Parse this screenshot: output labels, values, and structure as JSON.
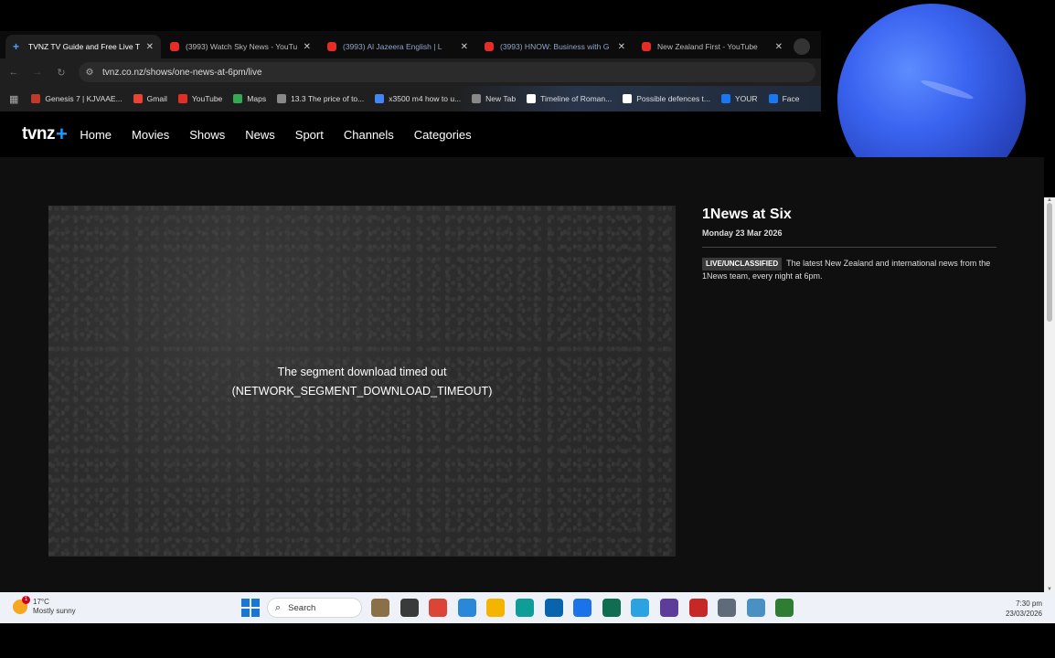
{
  "tabs": [
    {
      "title": "TVNZ TV Guide and Free Live T",
      "active": true,
      "icon": "tvnz-icon"
    },
    {
      "title": "(3993) Watch Sky News - YouTu",
      "active": false,
      "icon": "youtube-icon"
    },
    {
      "title": "(3993) Al Jazeera English | L",
      "active": false,
      "icon": "youtube-icon"
    },
    {
      "title": "(3993) HNOW: Business with G",
      "active": false,
      "icon": "youtube-icon"
    },
    {
      "title": "New Zealand First - YouTube",
      "active": false,
      "icon": "youtube-icon"
    }
  ],
  "toolbar": {
    "url": "tvnz.co.nz/shows/one-news-at-6pm/live"
  },
  "bookmarks": [
    {
      "label": "Genesis 7 | KJVAAE...",
      "icon": "bookmark-icon",
      "color": "#c0392b"
    },
    {
      "label": "Gmail",
      "icon": "gmail-icon",
      "color": "#ea4335"
    },
    {
      "label": "YouTube",
      "icon": "youtube-icon",
      "color": "#e52d27"
    },
    {
      "label": "Maps",
      "icon": "maps-icon",
      "color": "#34a853"
    },
    {
      "label": "13.3 The price of to...",
      "icon": "page-icon",
      "color": "#888888"
    },
    {
      "label": "x3500 m4 how to u...",
      "icon": "google-icon",
      "color": "#4285f4"
    },
    {
      "label": "New Tab",
      "icon": "page-icon",
      "color": "#888888"
    },
    {
      "label": "Timeline of Roman...",
      "icon": "wikipedia-icon",
      "color": "#ffffff"
    },
    {
      "label": "Possible defences t...",
      "icon": "cl-icon",
      "color": "#ffffff"
    },
    {
      "label": "YOUR",
      "icon": "facebook-icon",
      "color": "#1877f2"
    },
    {
      "label": "Face",
      "icon": "facebook-icon",
      "color": "#1877f2"
    }
  ],
  "site": {
    "logo": "tvnz",
    "logo_plus": "+",
    "nav": [
      "Home",
      "Movies",
      "Shows",
      "News",
      "Sport",
      "Channels",
      "Categories"
    ]
  },
  "player": {
    "error_line1": "The segment download timed out",
    "error_line2": "(NETWORK_SEGMENT_DOWNLOAD_TIMEOUT)"
  },
  "info": {
    "title": "1News at Six",
    "date": "Monday 23 Mar 2026",
    "badge": "LIVE/UNCLASSIFIED",
    "description": "The latest New Zealand and international news from the 1News team, every night at 6pm."
  },
  "taskbar": {
    "weather_temp": "17°C",
    "weather_desc": "Mostly sunny",
    "weather_alert": "1",
    "search_label": "Search",
    "time": "7:30 pm",
    "date": "23/03/2026",
    "apps": [
      {
        "name": "news-widget-icon",
        "color": "#8b6f47"
      },
      {
        "name": "file-explorer-icon",
        "color": "#3a3a3a"
      },
      {
        "name": "chrome-icon",
        "color": "#db4437"
      },
      {
        "name": "copilot-icon",
        "color": "#2b88d8"
      },
      {
        "name": "folder-icon",
        "color": "#f4b400"
      },
      {
        "name": "edge-icon",
        "color": "#0f9d9a"
      },
      {
        "name": "outlook-icon",
        "color": "#0a64ad"
      },
      {
        "name": "store-icon",
        "color": "#1a73e8"
      },
      {
        "name": "chat-app-icon",
        "color": "#0e6e4f"
      },
      {
        "name": "telegram-icon",
        "color": "#2aa3e0"
      },
      {
        "name": "purple-app-icon",
        "color": "#5c3d99"
      },
      {
        "name": "red-app-icon",
        "color": "#c62828"
      },
      {
        "name": "gamepad-icon",
        "color": "#5f6b7a"
      },
      {
        "name": "globe-app-icon",
        "color": "#4a90c2"
      },
      {
        "name": "settings-app-icon",
        "color": "#2e7d32"
      }
    ]
  }
}
